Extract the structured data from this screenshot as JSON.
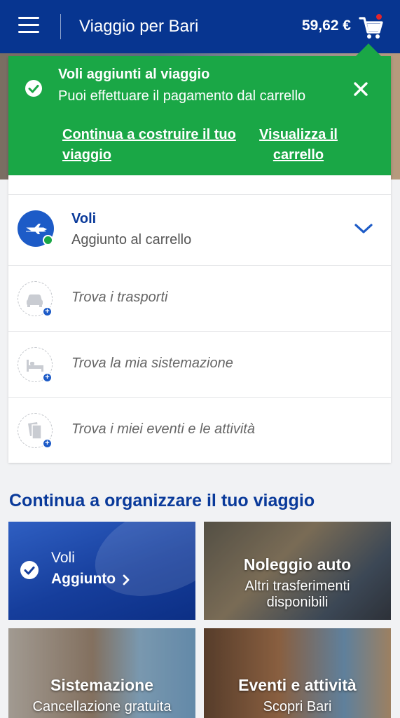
{
  "header": {
    "title": "Viaggio per Bari",
    "price": "59,62 €"
  },
  "toast": {
    "title": "Voli aggiunti al viaggio",
    "subtitle": "Puoi effettuare il pagamento dal carrello",
    "link_continue": "Continua a costruire il tuo viaggio",
    "link_cart": "Visualizza il carrello"
  },
  "trip_items": {
    "flights": {
      "title": "Voli",
      "status": "Aggiunto al carrello"
    },
    "transport": "Trova i trasporti",
    "accommodation": "Trova la mia sistemazione",
    "events": "Trova i miei eventi e le attività"
  },
  "section_title": "Continua a organizzare il tuo viaggio",
  "tiles": {
    "flights": {
      "title": "Voli",
      "status": "Aggiunto"
    },
    "car": {
      "title": "Noleggio auto",
      "subtitle": "Altri trasferimenti disponibili"
    },
    "hotel": {
      "title": "Sistemazione",
      "subtitle": "Cancellazione gratuita"
    },
    "events": {
      "title": "Eventi e attività",
      "subtitle": "Scopri Bari"
    }
  },
  "colors": {
    "brand_blue": "#073590",
    "success_green": "#1aa746",
    "accent_blue": "#1d5bc7",
    "cart_dot": "#e2252c"
  },
  "icons": [
    "menu-icon",
    "cart-icon",
    "check-icon",
    "close-icon",
    "plane-icon",
    "car-icon",
    "bed-icon",
    "ticket-icon",
    "chevron-down-icon",
    "chevron-right-icon",
    "plus-icon"
  ]
}
